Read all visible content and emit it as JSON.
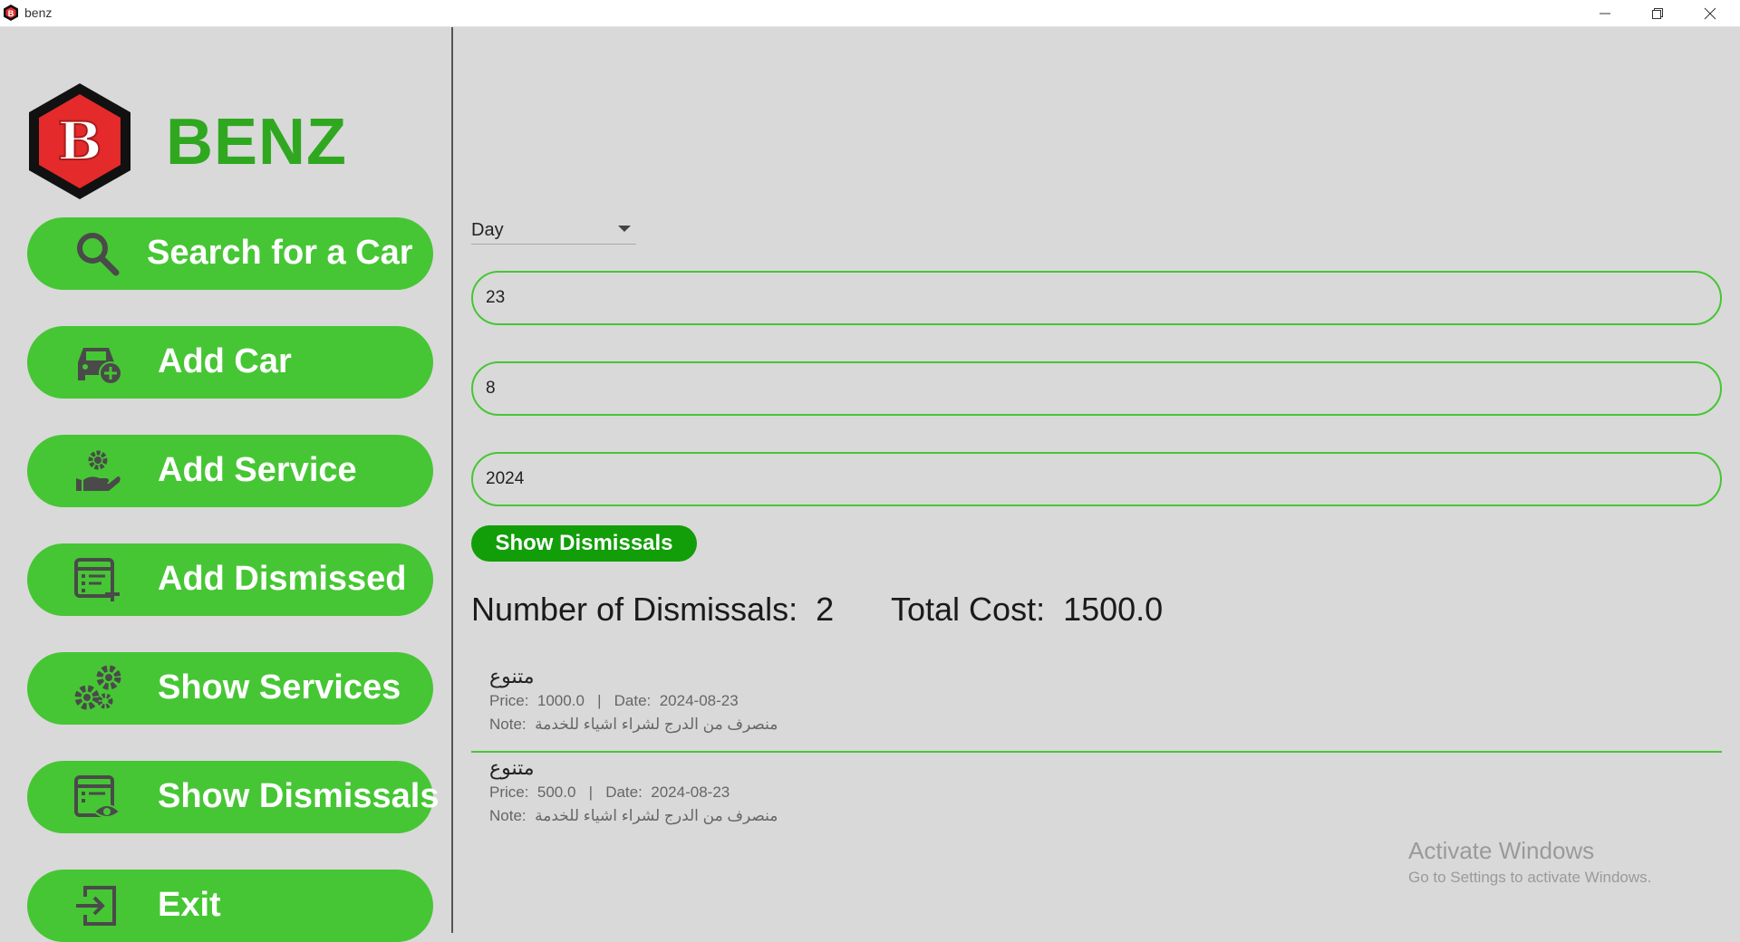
{
  "window": {
    "title": "benz"
  },
  "sidebar": {
    "brand": "BENZ",
    "logo_letter": "B",
    "items": [
      {
        "label": "Search for a Car",
        "icon": "search-icon"
      },
      {
        "label": "Add Car",
        "icon": "car-add-icon"
      },
      {
        "label": "Add Service",
        "icon": "hand-gear-icon"
      },
      {
        "label": "Add Dismissed",
        "icon": "list-add-icon"
      },
      {
        "label": "Show Services",
        "icon": "gears-icon"
      },
      {
        "label": "Show Dismissals",
        "icon": "list-eye-icon"
      },
      {
        "label": "Exit",
        "icon": "exit-icon"
      }
    ]
  },
  "filter": {
    "period_selected": "Day",
    "day_value": "23",
    "month_value": "8",
    "year_value": "2024",
    "show_button": "Show Dismissals"
  },
  "summary": {
    "count_text": "Number of Dismissals:  2",
    "total_text": "Total Cost:  1500.0"
  },
  "records": [
    {
      "name": "متنوع",
      "line1": "Price:  1000.0   |   Date:  2024-08-23",
      "line2": "Note:  منصرف من الدرج لشراء اشياء للخدمة"
    },
    {
      "name": "متنوع",
      "line1": "Price:  500.0   |   Date:  2024-08-23",
      "line2": "Note:  منصرف من الدرج لشراء اشياء للخدمة"
    }
  ],
  "watermark": {
    "line1": "Activate Windows",
    "line2": "Go to Settings to activate Windows."
  },
  "colors": {
    "accent": "#46c634",
    "brand": "#2fa820",
    "button_dark": "#129e09",
    "background": "#d9d9d9"
  }
}
